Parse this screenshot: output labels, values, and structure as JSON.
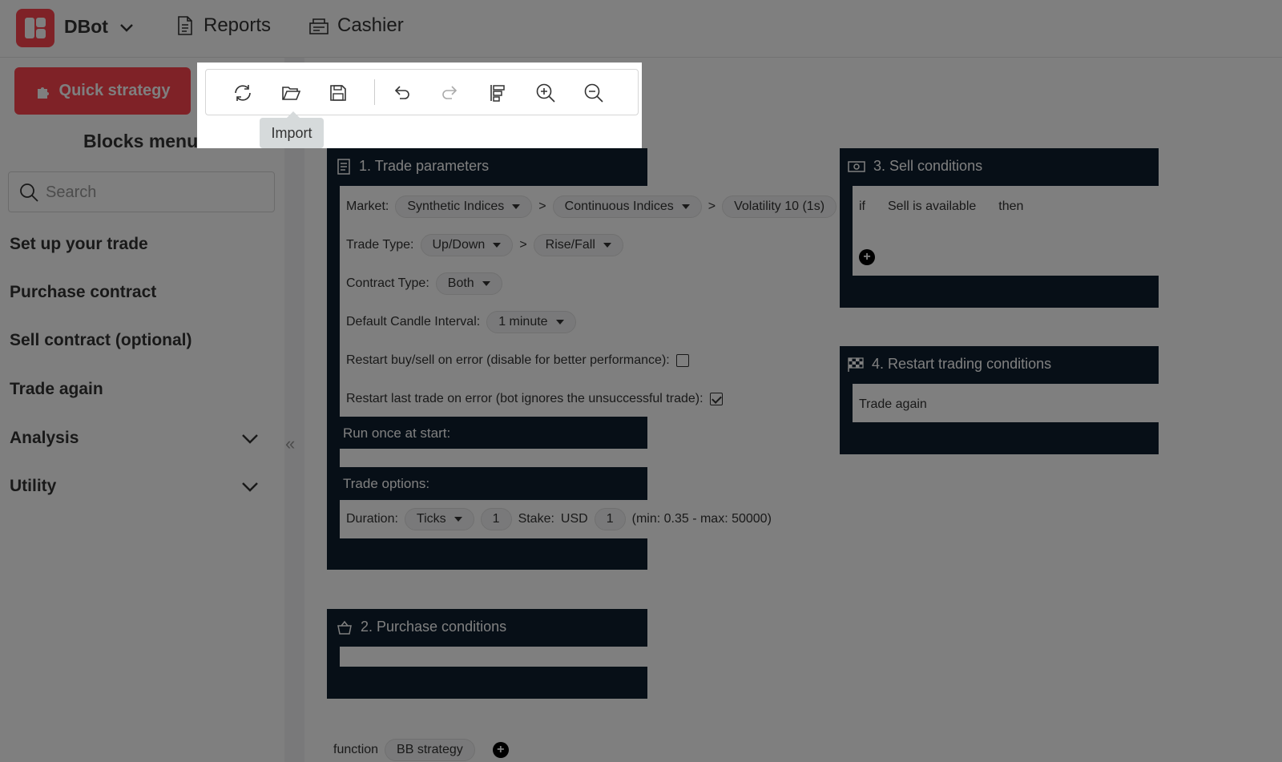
{
  "header": {
    "brand": "DBot",
    "nav": [
      {
        "label": "Reports",
        "icon": "reports-icon"
      },
      {
        "label": "Cashier",
        "icon": "cashier-icon"
      }
    ]
  },
  "sidebar": {
    "quick_strategy": "Quick strategy",
    "title": "Blocks menu",
    "search_placeholder": "Search",
    "items": [
      {
        "label": "Set up your trade"
      },
      {
        "label": "Purchase contract"
      },
      {
        "label": "Sell contract (optional)"
      },
      {
        "label": "Trade again"
      },
      {
        "label": "Analysis",
        "expandable": true
      },
      {
        "label": "Utility",
        "expandable": true
      }
    ]
  },
  "toolbar": {
    "tooltip": "Import",
    "buttons": [
      "reset-icon",
      "import-icon",
      "save-icon",
      "undo-icon",
      "redo-icon",
      "sort-icon",
      "zoom-in-icon",
      "zoom-out-icon"
    ]
  },
  "blocks": {
    "trade_parameters": {
      "title": "1. Trade parameters",
      "market_label": "Market:",
      "market": "Synthetic Indices",
      "submarket": "Continuous Indices",
      "symbol": "Volatility 10 (1s)",
      "sep": ">",
      "trade_type_label": "Trade Type:",
      "trade_type": "Up/Down",
      "trade_subtype": "Rise/Fall",
      "contract_type_label": "Contract Type:",
      "contract_type": "Both",
      "candle_label": "Default Candle Interval:",
      "candle": "1 minute",
      "restart_buysell": "Restart buy/sell on error (disable for better performance):",
      "restart_last": "Restart last trade on error (bot ignores the unsuccessful trade):",
      "run_once": "Run once at start:",
      "trade_options": "Trade options:",
      "duration_label": "Duration:",
      "duration_unit": "Ticks",
      "duration_value": "1",
      "stake_label": "Stake:",
      "currency": "USD",
      "stake_value": "1",
      "stake_range": "(min: 0.35 - max: 50000)"
    },
    "purchase": {
      "title": "2. Purchase conditions"
    },
    "sell": {
      "title": "3. Sell conditions",
      "if": "if",
      "condition": "Sell is available",
      "then": "then"
    },
    "restart": {
      "title": "4. Restart trading conditions",
      "trade_again": "Trade again"
    },
    "function": {
      "label": "function",
      "name": "BB strategy"
    }
  }
}
